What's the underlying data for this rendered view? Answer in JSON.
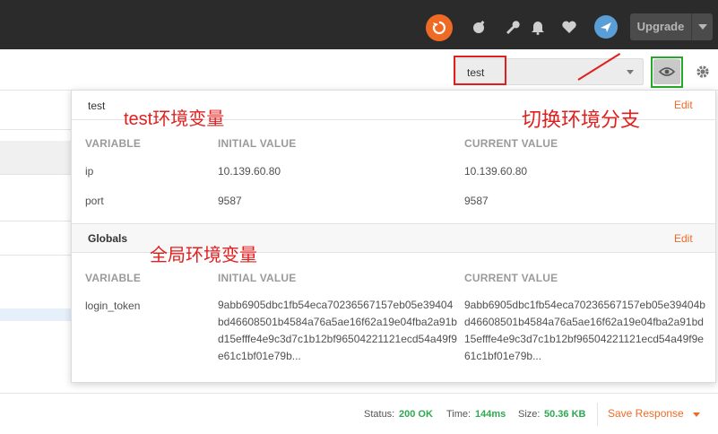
{
  "topbar": {
    "upgrade_label": "Upgrade",
    "accent_color": "#ef6b25"
  },
  "environment": {
    "selected": "test"
  },
  "annotations": {
    "env_label": "test环境变量",
    "switch_label": "切换环境分支",
    "globals_label": "全局环境变量"
  },
  "popover": {
    "env_section": {
      "title": "test",
      "edit_label": "Edit",
      "columns": [
        "VARIABLE",
        "INITIAL VALUE",
        "CURRENT VALUE"
      ],
      "rows": [
        {
          "variable": "ip",
          "initial": "10.139.60.80",
          "current": "10.139.60.80"
        },
        {
          "variable": "port",
          "initial": "9587",
          "current": "9587"
        }
      ]
    },
    "globals_section": {
      "title": "Globals",
      "edit_label": "Edit",
      "columns": [
        "VARIABLE",
        "INITIAL VALUE",
        "CURRENT VALUE"
      ],
      "rows": [
        {
          "variable": "login_token",
          "initial": "9abb6905dbc1fb54eca70236567157eb05e39404bd46608501b4584a76a5ae16f62a19e04fba2a91bd15efffe4e9c3d7c1b12bf96504221121ecd54a49f9e61c1bf01e79b...",
          "current": "9abb6905dbc1fb54eca70236567157eb05e39404bd46608501b4584a76a5ae16f62a19e04fba2a91bd15efffe4e9c3d7c1b12bf96504221121ecd54a49f9e61c1bf01e79b..."
        }
      ]
    }
  },
  "statusbar": {
    "status_label": "Status:",
    "status_value": "200 OK",
    "time_label": "Time:",
    "time_value": "144ms",
    "size_label": "Size:",
    "size_value": "50.36 KB",
    "save_label": "Save Response"
  }
}
